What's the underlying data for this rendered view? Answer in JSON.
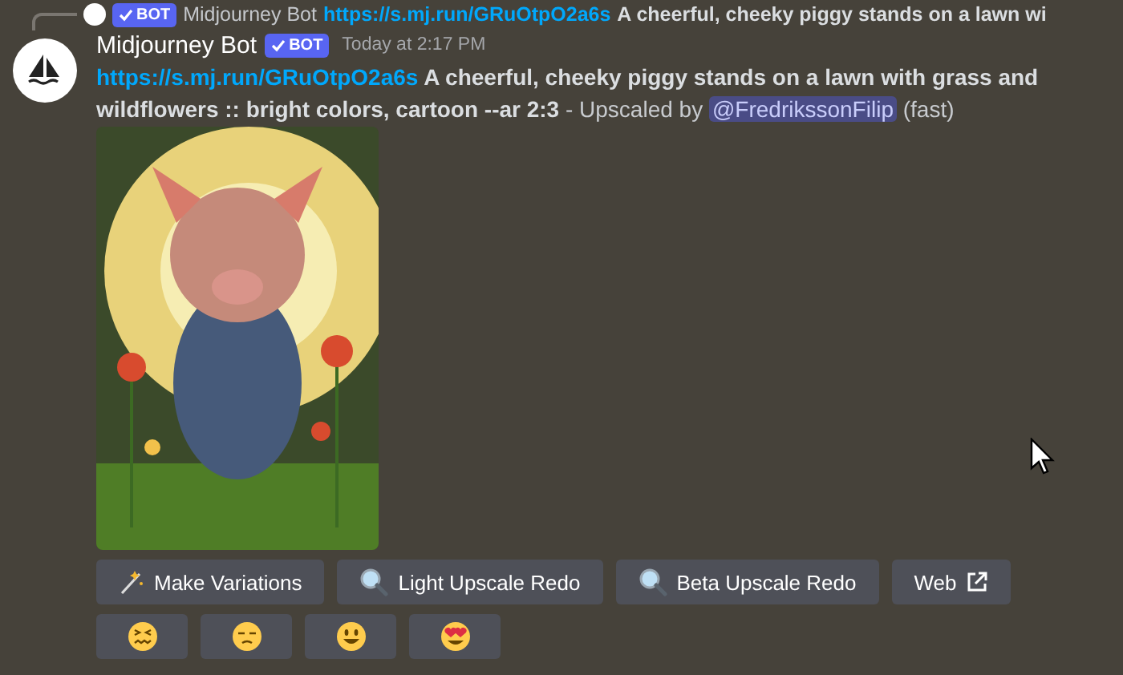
{
  "reply": {
    "badge": "BOT",
    "author": "Midjourney Bot",
    "link": "https://s.mj.run/GRuOtpO2a6s",
    "text": "A cheerful, cheeky piggy stands on a lawn wi"
  },
  "message": {
    "author": "Midjourney Bot",
    "badge": "BOT",
    "time": "Today at 2:17 PM",
    "link": "https://s.mj.run/GRuOtpO2a6s",
    "prompt": "A cheerful, cheeky piggy stands on a lawn with grass and wildflowers :: bright colors, cartoon --ar 2:3",
    "by": " - Upscaled by ",
    "mention": "@FredrikssonFilip",
    "suffix": " (fast)"
  },
  "buttons": [
    {
      "label": "Make Variations",
      "kind": "wand"
    },
    {
      "label": "Light Upscale Redo",
      "kind": "search"
    },
    {
      "label": "Beta Upscale Redo",
      "kind": "search"
    },
    {
      "label": "Web",
      "kind": "external"
    }
  ],
  "reactions": [
    {
      "kind": "confounded"
    },
    {
      "kind": "unamused"
    },
    {
      "kind": "smiley"
    },
    {
      "kind": "heart-eyes"
    }
  ]
}
